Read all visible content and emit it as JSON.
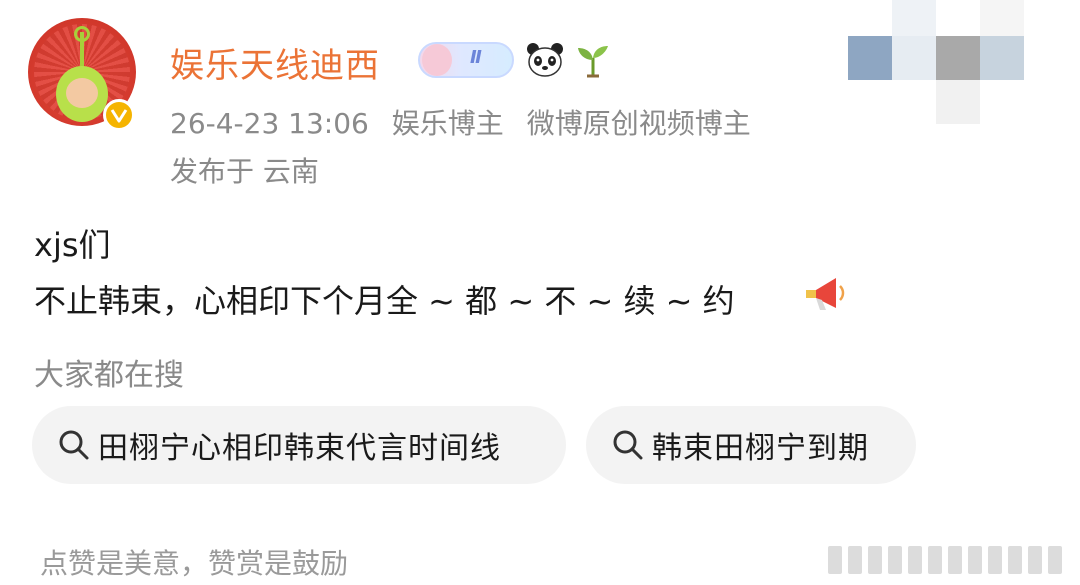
{
  "author": {
    "name": "娱乐天线迪西",
    "level_badge": "Ⅱ",
    "avatar_icon": "teletubby-dipsy-avatar",
    "verified_icon": "verified-v-badge",
    "emoji_badges": [
      "panda-icon",
      "sprout-icon"
    ]
  },
  "meta": {
    "timestamp": "26-4-23 13:06",
    "role1": "娱乐博主",
    "role2": "微博原创视频博主",
    "location": "发布于 云南"
  },
  "post": {
    "line1": "xjs们",
    "line2": "不止韩束，心相印下个月全 ~ 都 ~ 不 ~ 续 ~ 约",
    "trailing_emoji": "megaphone-icon"
  },
  "search": {
    "title": "大家都在搜",
    "chips": [
      {
        "label": "田栩宁心相印韩束代言时间线",
        "icon": "search-icon"
      },
      {
        "label": "韩束田栩宁到期",
        "icon": "search-icon"
      }
    ]
  },
  "footer": {
    "text": "点赞是美意，赞赏是鼓励"
  },
  "colors": {
    "username": "#eb7336",
    "meta_text": "#8a8a8a",
    "chip_bg": "#f3f3f3",
    "verified": "#f5b400"
  }
}
